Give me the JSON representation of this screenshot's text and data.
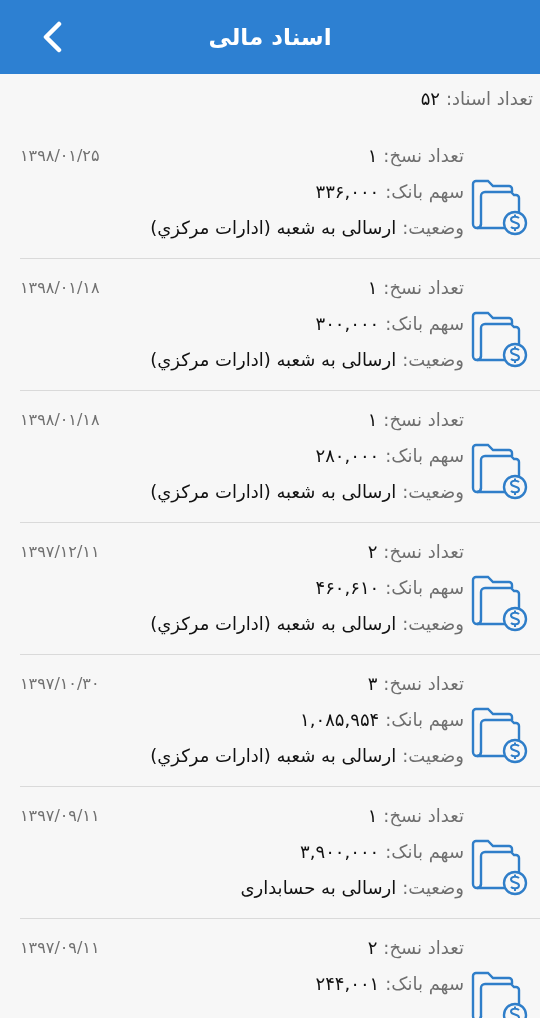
{
  "header": {
    "title": "اسناد مالی"
  },
  "summary": {
    "label": "تعداد اسناد:",
    "value": "۵۲"
  },
  "documents": [
    {
      "date": "۱۳۹۸/۰۱/۲۵",
      "fields": [
        {
          "label": "تعداد نسخ:",
          "value": "۱"
        },
        {
          "label": "سهم بانک:",
          "value": "۳۳۶,۰۰۰"
        },
        {
          "label": "وضعیت:",
          "value": "ارسالی به شعبه (ادارات مرکزي)"
        }
      ]
    },
    {
      "date": "۱۳۹۸/۰۱/۱۸",
      "fields": [
        {
          "label": "تعداد نسخ:",
          "value": "۱"
        },
        {
          "label": "سهم بانک:",
          "value": "۳۰۰,۰۰۰"
        },
        {
          "label": "وضعیت:",
          "value": "ارسالی به شعبه (ادارات مرکزي)"
        }
      ]
    },
    {
      "date": "۱۳۹۸/۰۱/۱۸",
      "fields": [
        {
          "label": "تعداد نسخ:",
          "value": "۱"
        },
        {
          "label": "سهم بانک:",
          "value": "۲۸۰,۰۰۰"
        },
        {
          "label": "وضعیت:",
          "value": "ارسالی به شعبه (ادارات مرکزي)"
        }
      ]
    },
    {
      "date": "۱۳۹۷/۱۲/۱۱",
      "fields": [
        {
          "label": "تعداد نسخ:",
          "value": "۲"
        },
        {
          "label": "سهم بانک:",
          "value": "۴۶۰,۶۱۰"
        },
        {
          "label": "وضعیت:",
          "value": "ارسالی به شعبه (ادارات مرکزي)"
        }
      ]
    },
    {
      "date": "۱۳۹۷/۱۰/۳۰",
      "fields": [
        {
          "label": "تعداد نسخ:",
          "value": "۳"
        },
        {
          "label": "سهم بانک:",
          "value": "۱,۰۸۵,۹۵۴"
        },
        {
          "label": "وضعیت:",
          "value": "ارسالی به شعبه (ادارات مرکزي)"
        }
      ]
    },
    {
      "date": "۱۳۹۷/۰۹/۱۱",
      "fields": [
        {
          "label": "تعداد نسخ:",
          "value": "۱"
        },
        {
          "label": "سهم بانک:",
          "value": "۳,۹۰۰,۰۰۰"
        },
        {
          "label": "وضعیت:",
          "value": "ارسالی به حسابداری"
        }
      ]
    },
    {
      "date": "۱۳۹۷/۰۹/۱۱",
      "fields": [
        {
          "label": "تعداد نسخ:",
          "value": "۲"
        },
        {
          "label": "سهم بانک:",
          "value": "۲۴۴,۰۰۱"
        }
      ]
    }
  ]
}
